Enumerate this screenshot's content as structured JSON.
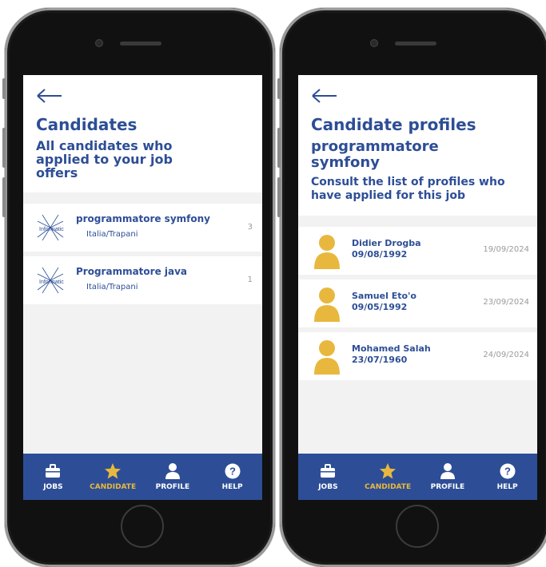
{
  "colors": {
    "primary": "#2d4e96",
    "accent": "#e8b83e",
    "muted": "#9a9a9a",
    "background": "#f2f2f2"
  },
  "left_screen": {
    "back_icon": "arrow-left-icon",
    "title": "Candidates",
    "subtitle": "All candidates who applied to your job offers",
    "jobs": [
      {
        "logo": "informatic-logo",
        "title": "programmatore symfony",
        "location": "Italia/Trapani",
        "count": "3"
      },
      {
        "logo": "informatic-logo",
        "title": "Programmatore java",
        "location": "Italia/Trapani",
        "count": "1"
      }
    ]
  },
  "right_screen": {
    "back_icon": "arrow-left-icon",
    "title": "Candidate profiles",
    "job_name": "programmatore symfony",
    "subtitle": "Consult the list of profiles who have applied for this job",
    "candidates": [
      {
        "name": "Didier Drogba",
        "birthdate": "09/08/1992",
        "applied": "19/09/2024"
      },
      {
        "name": "Samuel Eto'o",
        "birthdate": "09/05/1992",
        "applied": "23/09/2024"
      },
      {
        "name": "Mohamed Salah",
        "birthdate": "23/07/1960",
        "applied": "24/09/2024"
      }
    ]
  },
  "tabs": [
    {
      "label": "JOBS",
      "icon": "briefcase-icon",
      "active": false
    },
    {
      "label": "CANDIDATE",
      "icon": "star-icon",
      "active": true
    },
    {
      "label": "PROFILE",
      "icon": "user-icon",
      "active": false
    },
    {
      "label": "HELP",
      "icon": "help-icon",
      "active": false
    }
  ]
}
